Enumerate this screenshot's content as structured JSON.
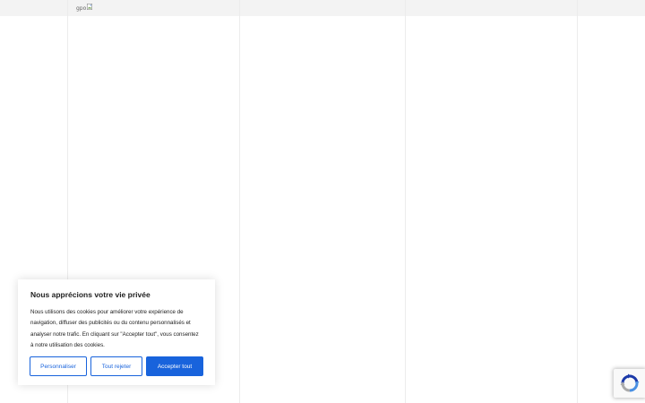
{
  "header": {
    "logo_alt": "gpo"
  },
  "cookie_banner": {
    "title": "Nous apprécions votre vie privée",
    "body": "Nous utilisons des cookies pour améliorer votre expérience de navigation, diffuser des publicités ou du contenu personnalisés et analyser notre trafic. En cliquant sur \"Accepter tout\", vous consentez à notre utilisation des cookies.",
    "customize_label": "Personnaliser",
    "reject_label": "Tout rejeter",
    "accept_label": "Accepter tout"
  },
  "icons": {
    "logo": "broken-image-icon",
    "recaptcha": "recaptcha-icon"
  },
  "colors": {
    "accent": "#1863dc",
    "header_bg": "#f3f3f3",
    "text": "#212121"
  }
}
